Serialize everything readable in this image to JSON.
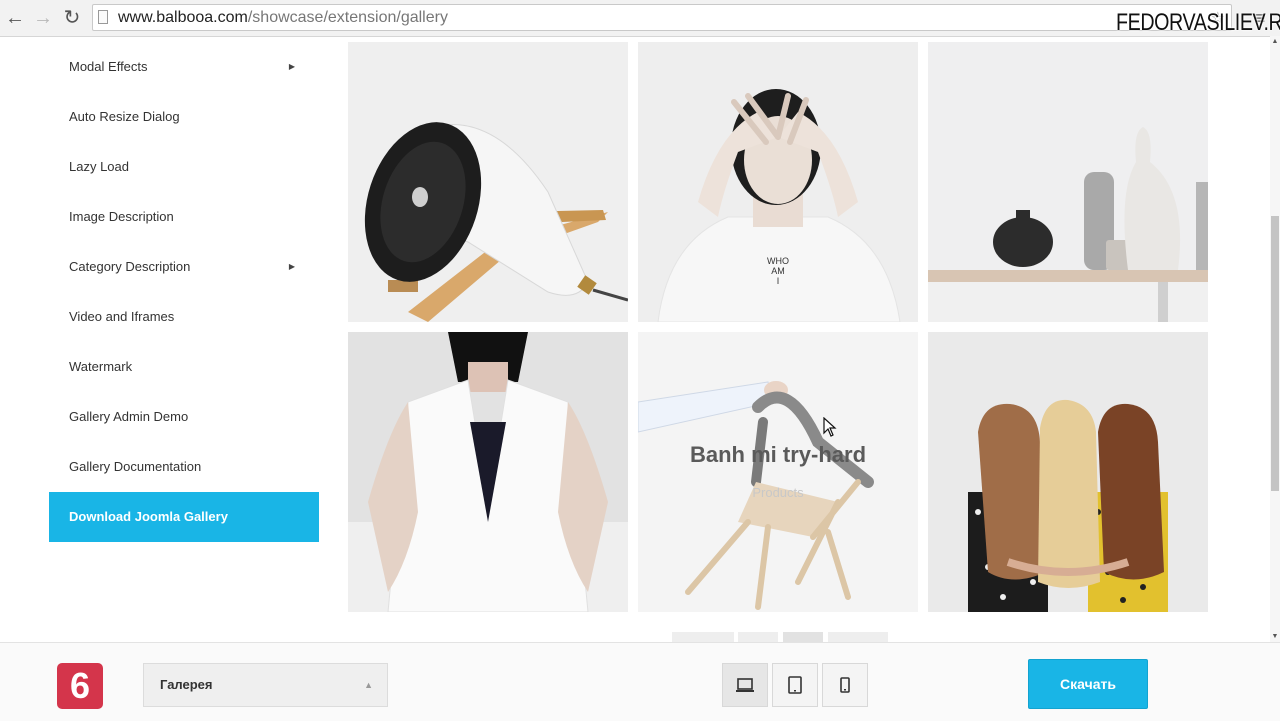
{
  "browser": {
    "url_host": "www.balbooa.com",
    "url_path": "/showcase/extension/gallery"
  },
  "watermark": "FEDORVASILIEV.RU",
  "sidebar": {
    "items": [
      {
        "label": "Modal Effects",
        "has_submenu": true
      },
      {
        "label": "Auto Resize Dialog",
        "has_submenu": false
      },
      {
        "label": "Lazy Load",
        "has_submenu": false
      },
      {
        "label": "Image Description",
        "has_submenu": false
      },
      {
        "label": "Category Description",
        "has_submenu": true
      },
      {
        "label": "Video and Iframes",
        "has_submenu": false
      },
      {
        "label": "Watermark",
        "has_submenu": false
      },
      {
        "label": "Gallery Admin Demo",
        "has_submenu": false
      },
      {
        "label": "Gallery Documentation",
        "has_submenu": false
      },
      {
        "label": "Download Joomla Gallery",
        "has_submenu": false,
        "active": true
      }
    ]
  },
  "gallery": {
    "hover_item": {
      "title": "Banh mi try-hard",
      "category": "Products"
    },
    "shirt_text": "WHO\nAM\nI"
  },
  "bottom_bar": {
    "logo_text": "6",
    "theme_select": "Галерея",
    "download_label": "Скачать"
  },
  "colors": {
    "accent": "#19b5e6",
    "logo_bg": "#d4354b"
  }
}
